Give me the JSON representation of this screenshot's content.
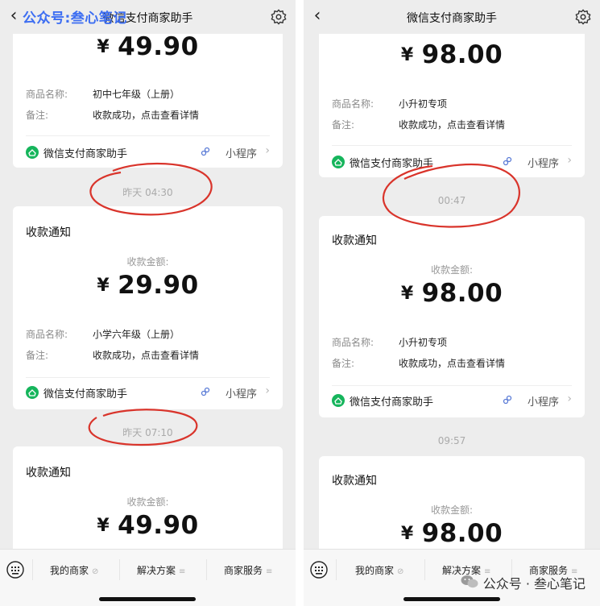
{
  "left": {
    "header": {
      "title": "微信支付商家助手",
      "watermark": "公众号:叁心笔记"
    },
    "cards": [
      {
        "amount": "49.90",
        "product_label": "商品名称:",
        "product": "初中七年级（上册）",
        "note_label": "备注:",
        "note": "收款成功，点击查看详情",
        "app_name": "微信支付商家助手",
        "mini_program": "小程序"
      },
      {
        "title": "收款通知",
        "amount_label": "收款金额:",
        "amount": "29.90",
        "product_label": "商品名称:",
        "product": "小学六年级（上册）",
        "note_label": "备注:",
        "note": "收款成功，点击查看详情",
        "app_name": "微信支付商家助手",
        "mini_program": "小程序"
      },
      {
        "title": "收款通知",
        "amount_label": "收款金额:",
        "amount": "49.90"
      }
    ],
    "times": [
      "昨天 04:30",
      "昨天 07:10"
    ],
    "tabs": [
      "我的商家",
      "解决方案",
      "商家服务"
    ]
  },
  "right": {
    "header": {
      "title": "微信支付商家助手"
    },
    "cards": [
      {
        "amount": "98.00",
        "product_label": "商品名称:",
        "product": "小升初专项",
        "note_label": "备注:",
        "note": "收款成功，点击查看详情",
        "app_name": "微信支付商家助手",
        "mini_program": "小程序"
      },
      {
        "title": "收款通知",
        "amount_label": "收款金额:",
        "amount": "98.00",
        "product_label": "商品名称:",
        "product": "小升初专项",
        "note_label": "备注:",
        "note": "收款成功，点击查看详情",
        "app_name": "微信支付商家助手",
        "mini_program": "小程序"
      },
      {
        "title": "收款通知",
        "amount_label": "收款金额:",
        "amount": "98.00"
      }
    ],
    "times": [
      "00:47",
      "09:57"
    ],
    "tabs": [
      "我的商家",
      "解决方案",
      "商家服务"
    ],
    "watermark": "公众号 · 叁心笔记"
  },
  "currency_symbol": "¥",
  "colors": {
    "brand_green": "#16b55c",
    "annotation_red": "#d9342b",
    "watermark_blue": "#3d6ef2"
  }
}
